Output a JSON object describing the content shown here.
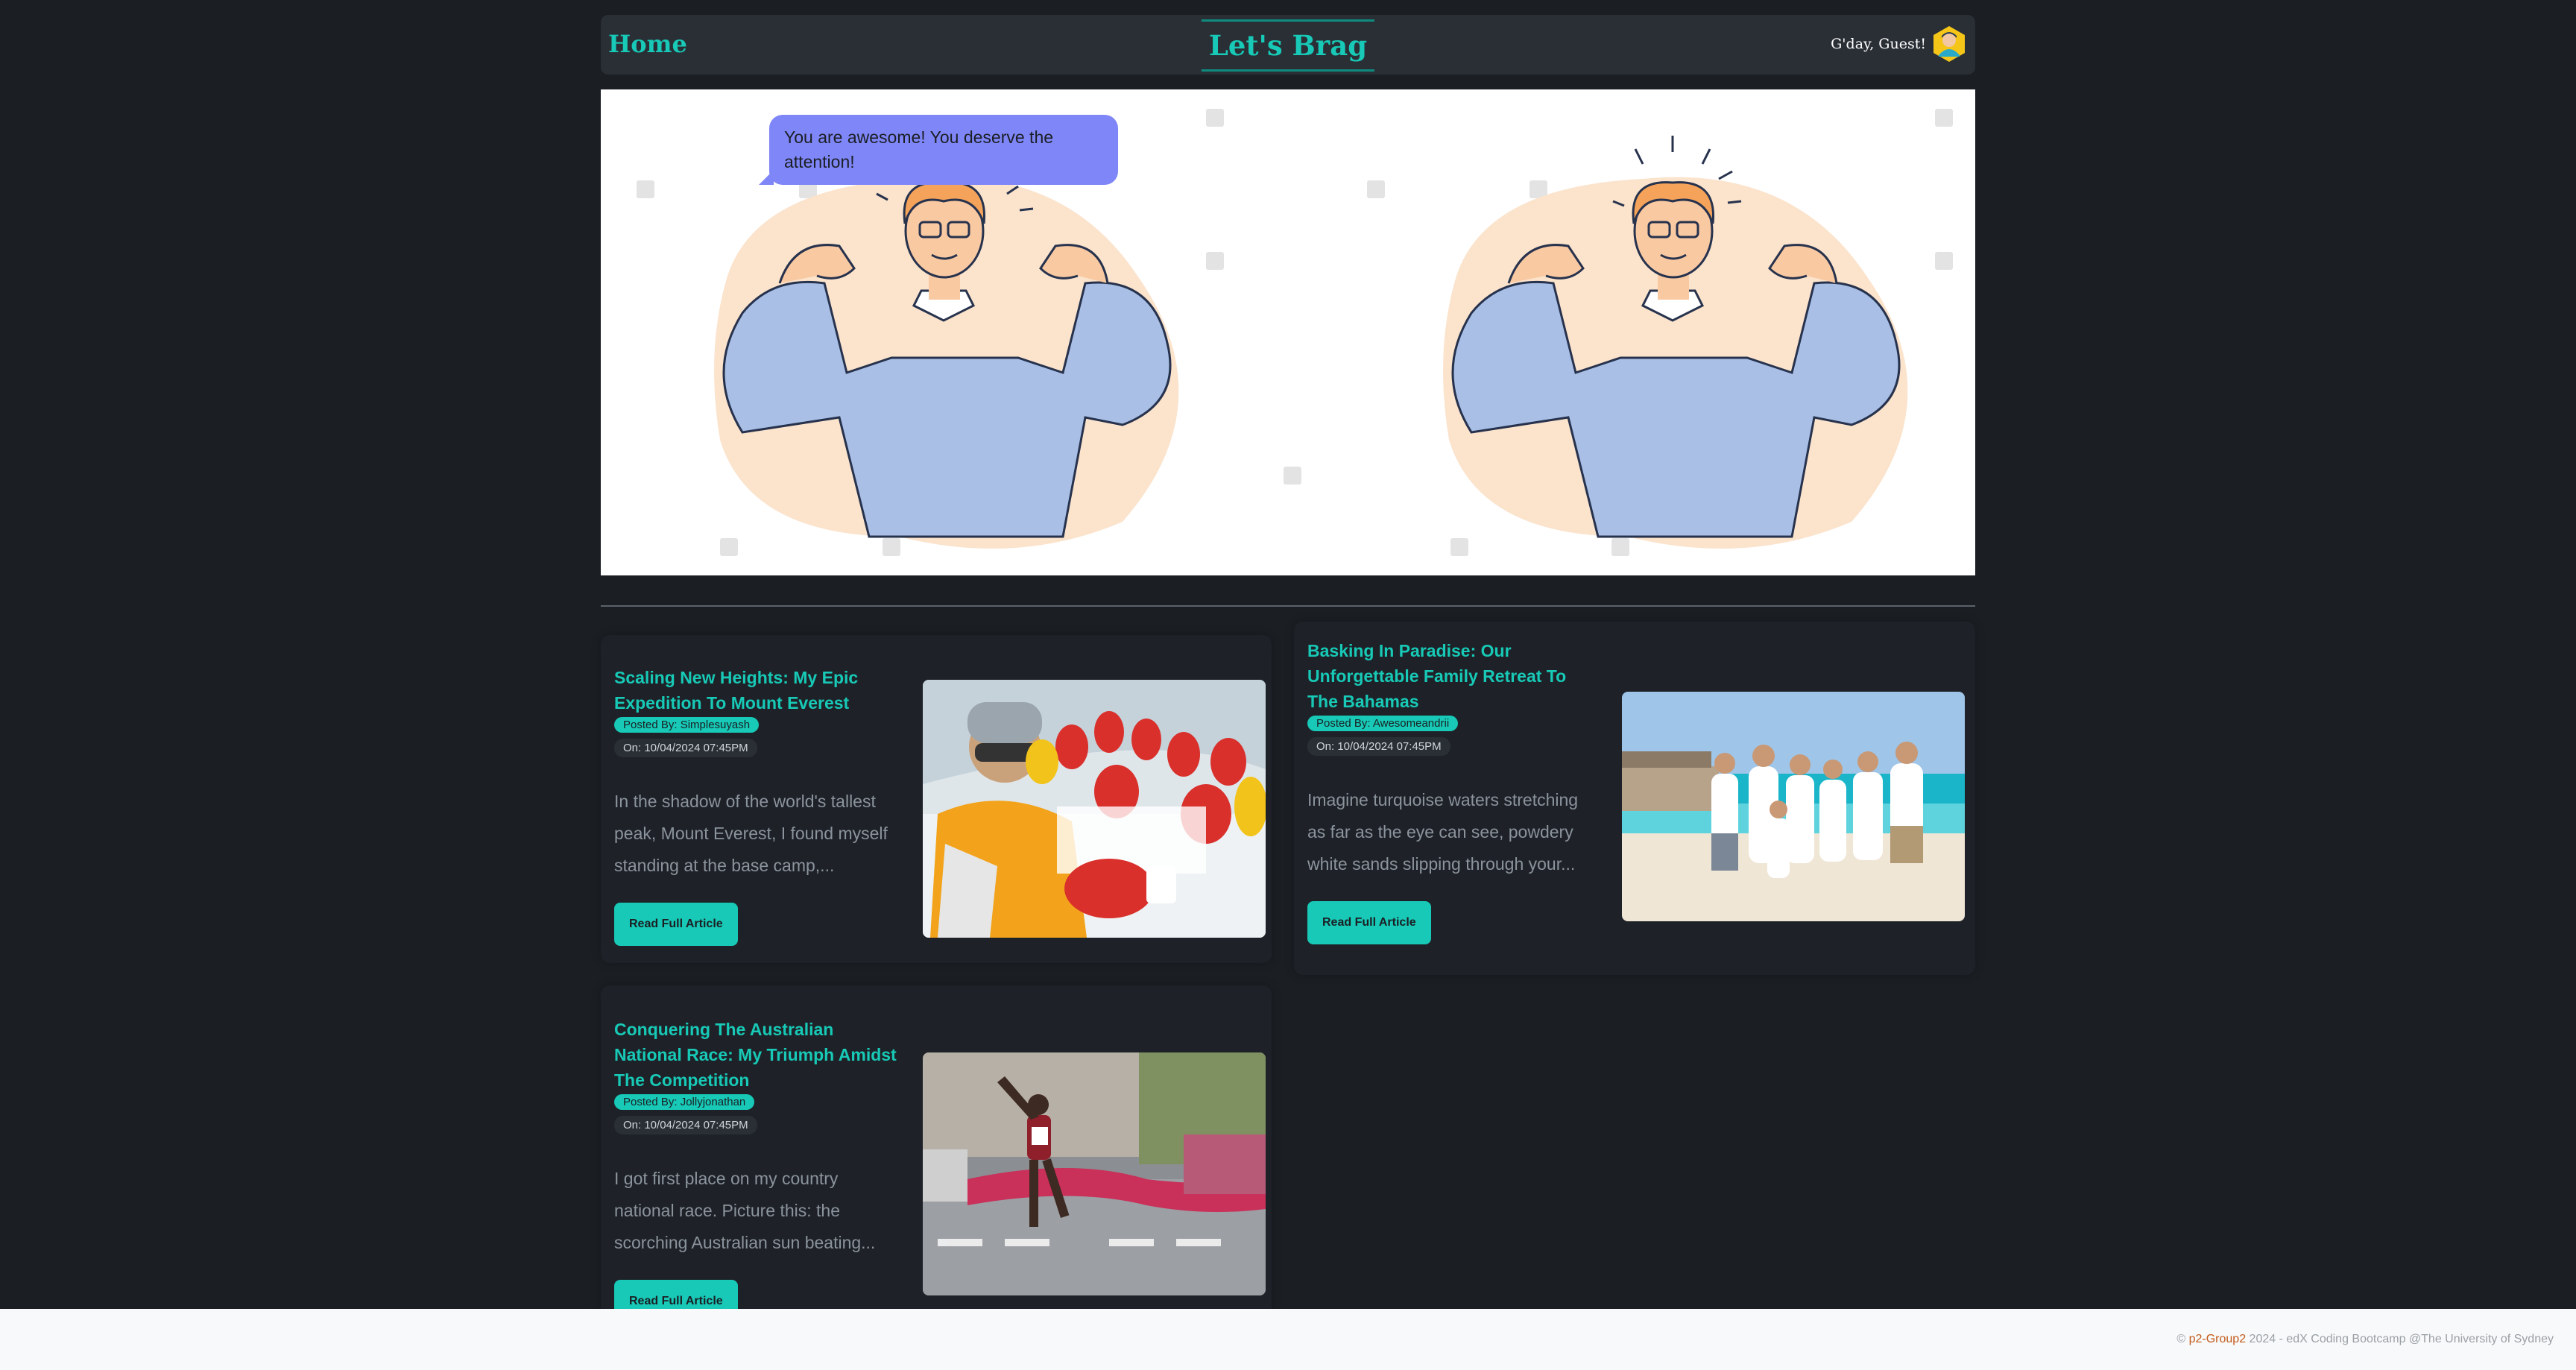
{
  "nav": {
    "home_label": "Home",
    "brand": "Let's Brag",
    "greeting": "G'day, Guest!"
  },
  "hero": {
    "bubble_text": "You are awesome! You deserve the attention!"
  },
  "posts": [
    {
      "title": "Scaling New Heights: My Epic Expedition To Mount Everest",
      "author": "Posted By: Simplesuyash",
      "date": "On: 10/04/2024 07:45PM",
      "excerpt": "In the shadow of the world's tallest peak, Mount Everest, I found myself standing at the base camp,...",
      "button": "Read Full Article"
    },
    {
      "title": "Basking In Paradise: Our Unforgettable Family Retreat To The Bahamas",
      "author": "Posted By: Awesomeandrii",
      "date": "On: 10/04/2024 07:45PM",
      "excerpt": "Imagine turquoise waters stretching as far as the eye can see, powdery white sands slipping through your...",
      "button": "Read Full Article"
    },
    {
      "title": "Conquering The Australian National Race: My Triumph Amidst The Competition",
      "author": "Posted By: Jollyjonathan",
      "date": "On: 10/04/2024 07:45PM",
      "excerpt": "I got first place on my country national race. Picture this: the scorching Australian sun beating...",
      "button": "Read Full Article"
    }
  ],
  "footer": {
    "copyright": "©",
    "link_text": "p2-Group2",
    "rest": "2024 - edX Coding Bootcamp @The University of Sydney"
  },
  "colors": {
    "accent": "#17c9b6",
    "background": "#1b1f24",
    "bubble": "#7f86f7",
    "footer_link": "#c35a1b"
  }
}
